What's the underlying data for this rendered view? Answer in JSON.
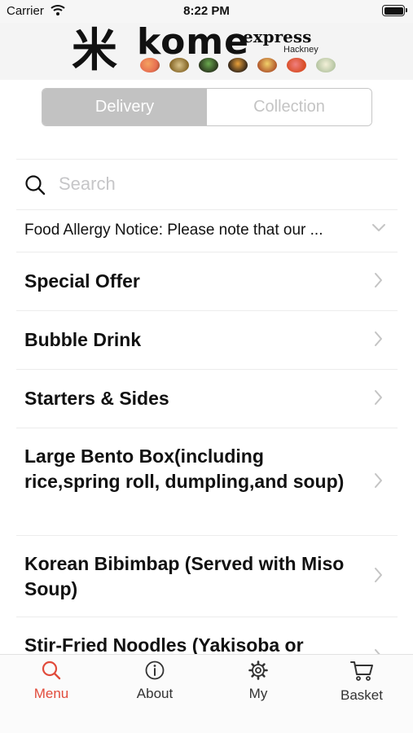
{
  "status": {
    "carrier": "Carrier",
    "time": "8:22 PM"
  },
  "header": {
    "kanji": "米",
    "brand": "kome",
    "sub_brand": "express",
    "location": "Hackney"
  },
  "segment": {
    "delivery": "Delivery",
    "collection": "Collection",
    "selected": "Delivery"
  },
  "search": {
    "placeholder": "Search",
    "value": ""
  },
  "notice": {
    "text": "Food Allergy Notice: Please note that our ..."
  },
  "categories": [
    {
      "label": "Special Offer"
    },
    {
      "label": "Bubble Drink"
    },
    {
      "label": "Starters & Sides"
    },
    {
      "label": "Large Bento Box(including rice,spring roll, dumpling,and soup)"
    },
    {
      "label": "Korean Bibimbap (Served with Miso Soup)"
    },
    {
      "label": "Stir-Fried  Noodles (Yakisoba or"
    }
  ],
  "tabs": [
    {
      "label": "Menu",
      "icon": "search-icon",
      "active": true
    },
    {
      "label": "About",
      "icon": "info-icon",
      "active": false
    },
    {
      "label": "My",
      "icon": "gear-icon",
      "active": false
    },
    {
      "label": "Basket",
      "icon": "cart-icon",
      "active": false
    }
  ],
  "colors": {
    "accent": "#e14b3b",
    "segment_active": "#c2c2c2",
    "placeholder": "#c6c6c8"
  }
}
